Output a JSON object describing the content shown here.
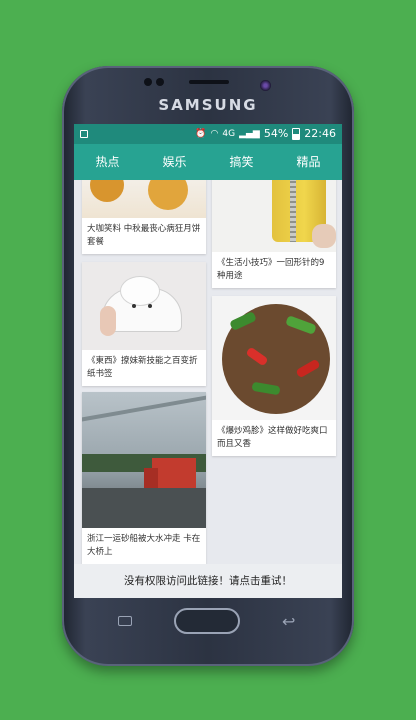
{
  "device": {
    "brand": "SAMSUNG"
  },
  "status_bar": {
    "network": "4G",
    "battery_percent": "54%",
    "time": "22:46"
  },
  "tabs": [
    "热点",
    "娱乐",
    "搞笑",
    "精品"
  ],
  "cards": {
    "left": [
      {
        "title": "大咖笑料 中秋最丧心病狂月饼套餐"
      },
      {
        "title": "《東西》撩妹新技能之百变折纸书签"
      },
      {
        "title": "浙江一运砂船被大水冲走 卡在大桥上"
      }
    ],
    "right": [
      {
        "title": "《生活小技巧》一回形针的9种用途"
      },
      {
        "title": "《爆炒鸡胗》这样做好吃爽口而且又香"
      }
    ]
  },
  "footer": {
    "message": "没有权限访问此链接！请点击重试！"
  },
  "colors": {
    "background": "#4caf50",
    "tabbar": "#27a392",
    "statusbar": "#1f8a7c"
  }
}
